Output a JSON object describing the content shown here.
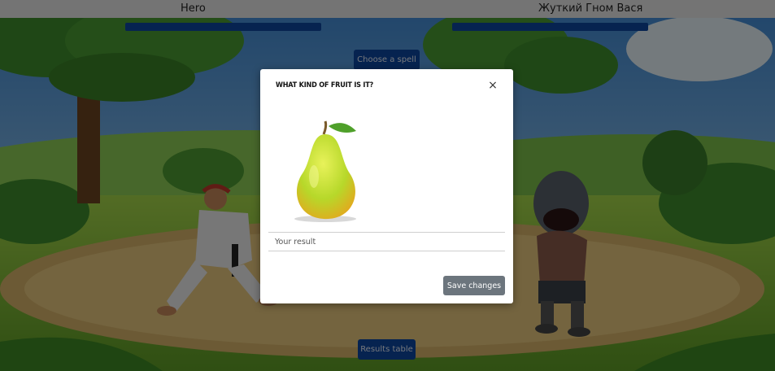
{
  "hero": {
    "name": "Hero",
    "health": 1.0
  },
  "enemy": {
    "name": "Жуткий Гном Вася",
    "health": 1.0
  },
  "buttons": {
    "spell": "Choose a spell",
    "results": "Results table"
  },
  "modal": {
    "title": "WHAT KIND OF FRUIT IS IT?",
    "close": "×",
    "input_placeholder": "Your result",
    "input_value": "",
    "save": "Save changes",
    "image": "pear"
  },
  "colors": {
    "accent": "#0d47a1",
    "secondary": "#6c757d",
    "modal_bg": "#ffffff"
  }
}
